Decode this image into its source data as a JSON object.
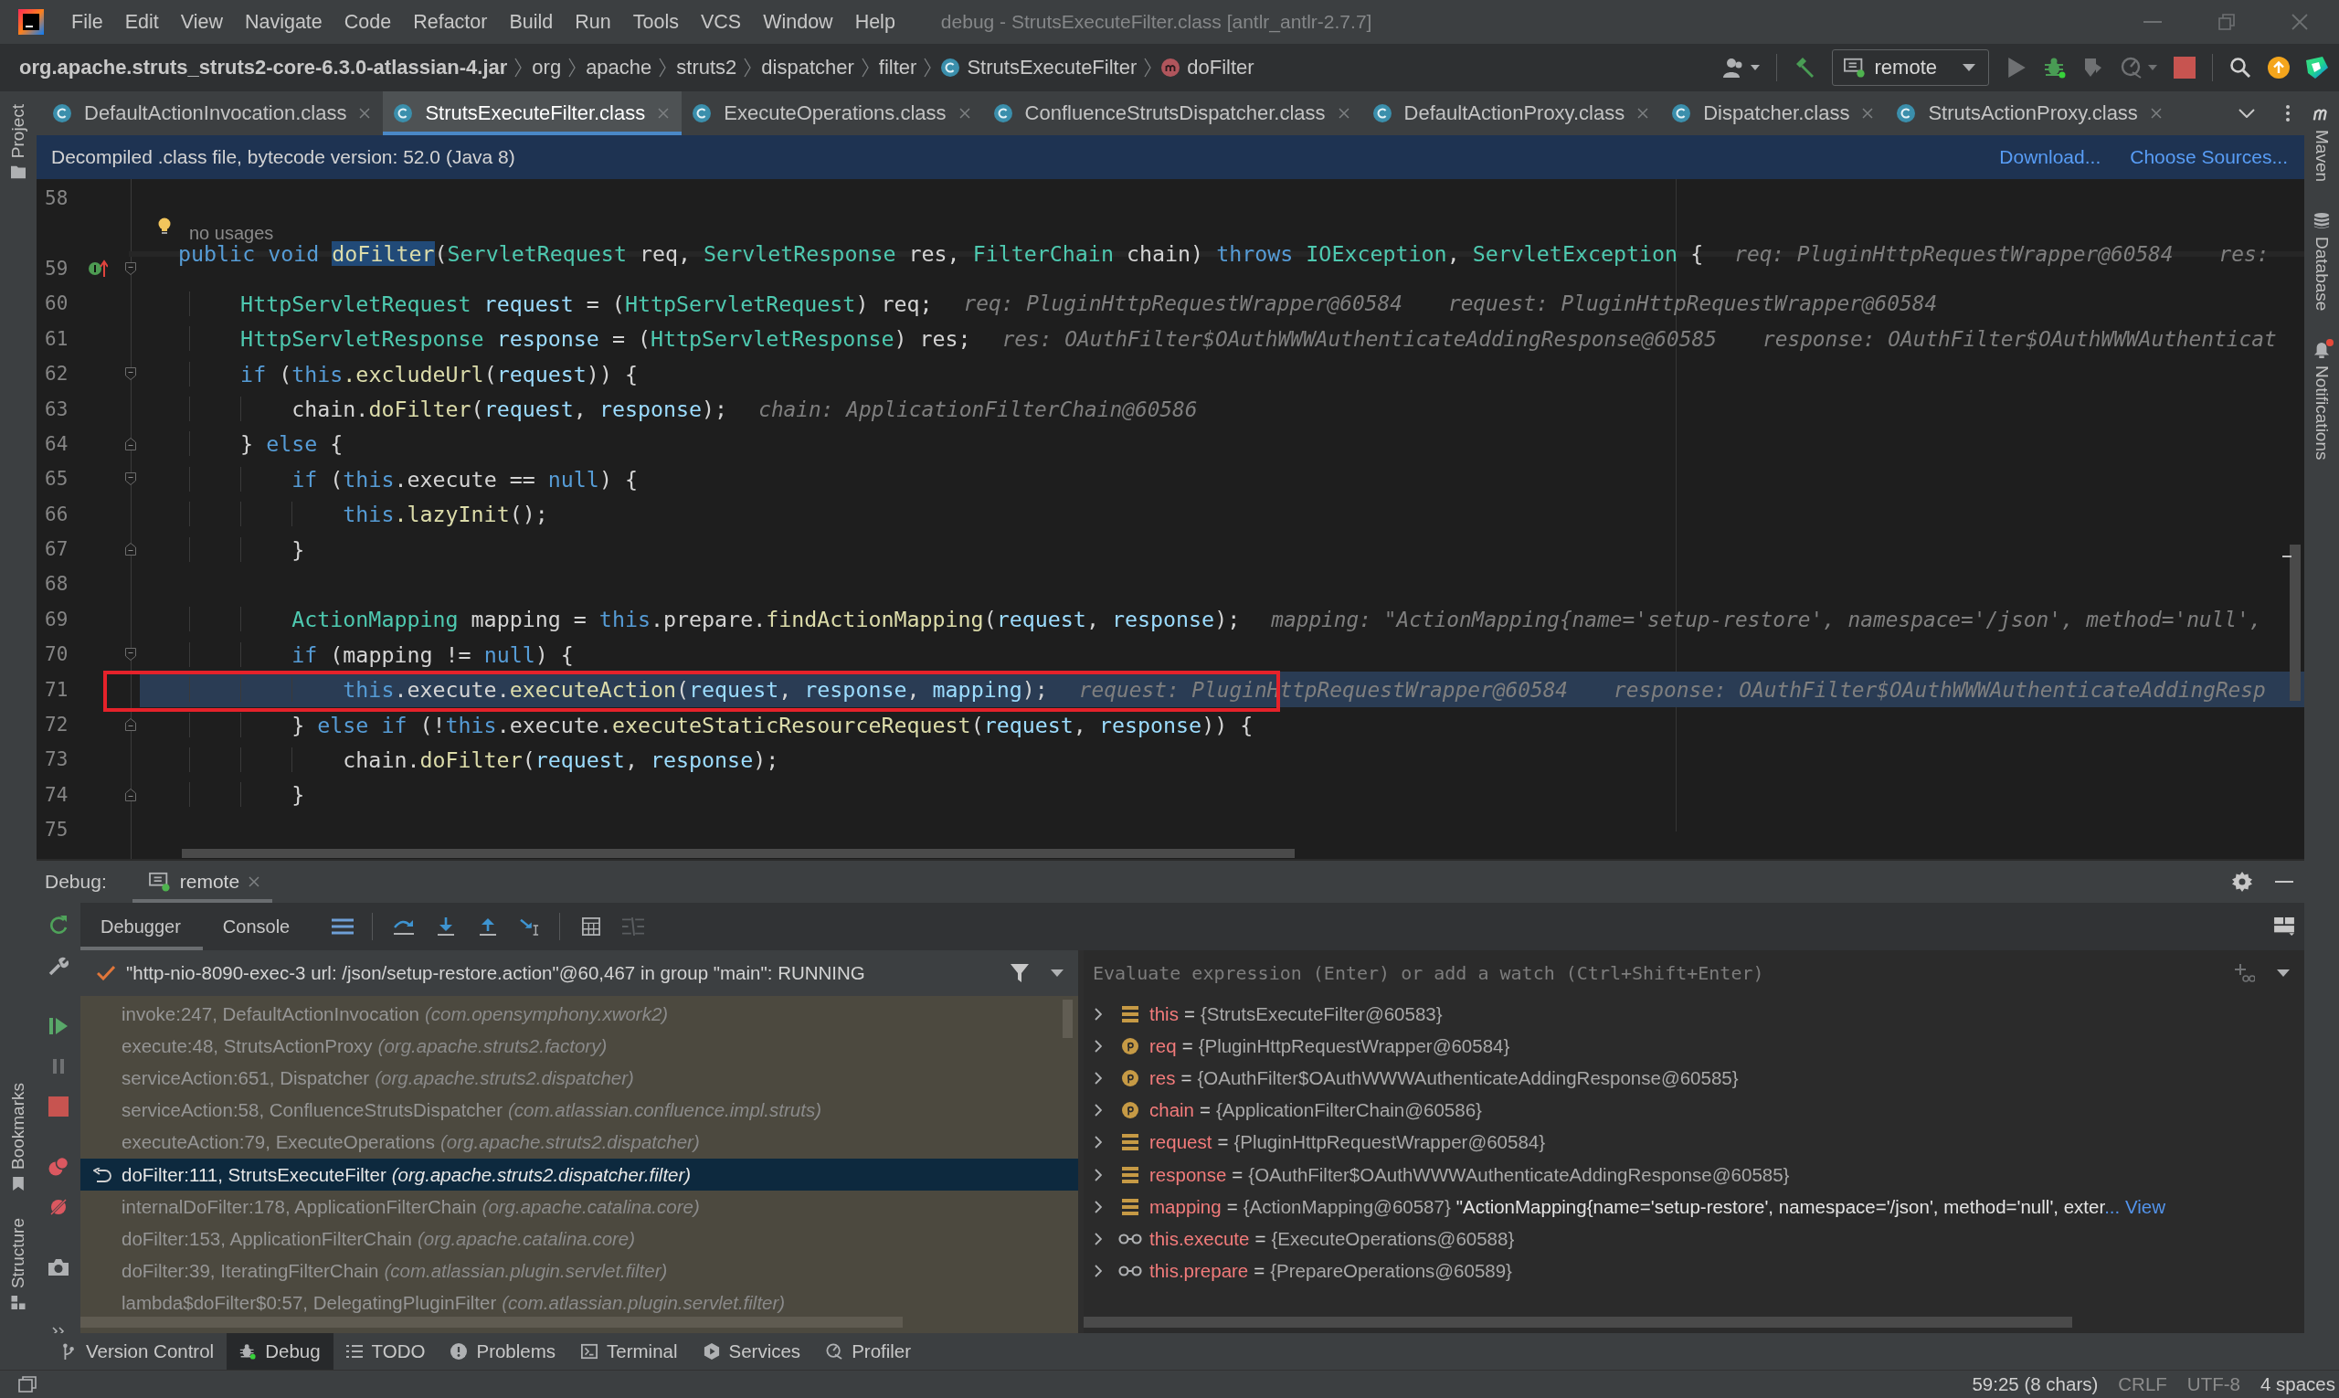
{
  "window": {
    "title": "debug - StrutsExecuteFilter.class [antlr_antlr-2.7.7]"
  },
  "menu": [
    "File",
    "Edit",
    "View",
    "Navigate",
    "Code",
    "Refactor",
    "Build",
    "Run",
    "Tools",
    "VCS",
    "Window",
    "Help"
  ],
  "breadcrumbs": [
    {
      "kind": "jar",
      "label": "org.apache.struts_struts2-core-6.3.0-atlassian-4.jar"
    },
    {
      "kind": "package",
      "label": "org"
    },
    {
      "kind": "package",
      "label": "apache"
    },
    {
      "kind": "package",
      "label": "struts2"
    },
    {
      "kind": "package",
      "label": "dispatcher"
    },
    {
      "kind": "package",
      "label": "filter"
    },
    {
      "kind": "class",
      "label": "StrutsExecuteFilter"
    },
    {
      "kind": "method",
      "label": "doFilter"
    }
  ],
  "toolbar": {
    "run_configuration": "remote"
  },
  "tabs": [
    {
      "label": "DefaultActionInvocation.class",
      "selected": false
    },
    {
      "label": "StrutsExecuteFilter.class",
      "selected": true
    },
    {
      "label": "ExecuteOperations.class",
      "selected": false
    },
    {
      "label": "ConfluenceStrutsDispatcher.class",
      "selected": false
    },
    {
      "label": "DefaultActionProxy.class",
      "selected": false
    },
    {
      "label": "Dispatcher.class",
      "selected": false
    },
    {
      "label": "StrutsActionProxy.class",
      "selected": false
    }
  ],
  "left_tool_strip": {
    "top": [
      {
        "kind": "project",
        "label": "Project"
      }
    ],
    "bottom": [
      {
        "kind": "bookmarks",
        "label": "Bookmarks"
      },
      {
        "kind": "structure",
        "label": "Structure"
      }
    ]
  },
  "right_tool_strip": [
    {
      "kind": "build_tool",
      "label": "Maven",
      "badge": false
    },
    {
      "kind": "database",
      "label": "Database",
      "badge": false
    },
    {
      "kind": "notifications",
      "label": "Notifications",
      "badge": true
    }
  ],
  "banner": {
    "text": "Decompiled .class file, bytecode version: 52.0 (Java 8)",
    "links": [
      "Download...",
      "Choose Sources..."
    ]
  },
  "editor": {
    "lines": [
      {
        "kind": "code",
        "number": "58",
        "marker": false,
        "boxed": false,
        "fold_start": false,
        "fold_end": false,
        "caret_line": false,
        "execution_point": false
      },
      {
        "kind": "annotation",
        "text": "no usages",
        "marker": false,
        "boxed": false,
        "fold_start": false,
        "fold_end": false,
        "caret_line": false,
        "execution_point": false
      },
      {
        "kind": "code",
        "number": "59",
        "marker": true,
        "boxed": false,
        "fold_start": true,
        "fold_end": false,
        "caret_line": true,
        "execution_point": false,
        "tokens": [
          {
            "kind": "keyword",
            "text": "public void "
          },
          {
            "kind": "highlight",
            "text": "doFilter"
          },
          {
            "kind": "plain",
            "text": "("
          },
          {
            "kind": "type",
            "text": "ServletRequest"
          },
          {
            "kind": "plain",
            "text": " req, "
          },
          {
            "kind": "type",
            "text": "ServletResponse"
          },
          {
            "kind": "plain",
            "text": " res, "
          },
          {
            "kind": "type",
            "text": "FilterChain"
          },
          {
            "kind": "plain",
            "text": " chain) "
          },
          {
            "kind": "keyword",
            "text": "throws "
          },
          {
            "kind": "type",
            "text": "IOException"
          },
          {
            "kind": "plain",
            "text": ", "
          },
          {
            "kind": "type",
            "text": "ServletException"
          },
          {
            "kind": "plain",
            "text": " {"
          }
        ],
        "hints": [
          "req: PluginHttpRequestWrapper@60584",
          "res:"
        ]
      },
      {
        "kind": "code",
        "number": "60",
        "marker": false,
        "boxed": false,
        "fold_start": false,
        "fold_end": false,
        "caret_line": false,
        "execution_point": false,
        "tokens": [
          {
            "kind": "type",
            "text": "    HttpServletRequest "
          },
          {
            "kind": "variable",
            "text": "request"
          },
          {
            "kind": "plain",
            "text": " = ("
          },
          {
            "kind": "type",
            "text": "HttpServletRequest"
          },
          {
            "kind": "plain",
            "text": ") req;"
          }
        ],
        "hints": [
          "req: PluginHttpRequestWrapper@60584",
          "request: PluginHttpRequestWrapper@60584"
        ]
      },
      {
        "kind": "code",
        "number": "61",
        "marker": false,
        "boxed": false,
        "fold_start": false,
        "fold_end": false,
        "caret_line": false,
        "execution_point": false,
        "tokens": [
          {
            "kind": "type",
            "text": "    HttpServletResponse "
          },
          {
            "kind": "variable",
            "text": "response"
          },
          {
            "kind": "plain",
            "text": " = ("
          },
          {
            "kind": "type",
            "text": "HttpServletResponse"
          },
          {
            "kind": "plain",
            "text": ") res;"
          }
        ],
        "hints": [
          "res: OAuthFilter$OAuthWWWAuthenticateAddingResponse@60585",
          "response: OAuthFilter$OAuthWWWAuthenticat"
        ]
      },
      {
        "kind": "code",
        "number": "62",
        "marker": false,
        "boxed": false,
        "fold_start": true,
        "fold_end": false,
        "caret_line": false,
        "execution_point": false,
        "tokens": [
          {
            "kind": "keyword",
            "text": "    if"
          },
          {
            "kind": "plain",
            "text": " ("
          },
          {
            "kind": "keyword",
            "text": "this"
          },
          {
            "kind": "method",
            "text": ".excludeUrl"
          },
          {
            "kind": "plain",
            "text": "("
          },
          {
            "kind": "variable",
            "text": "request"
          },
          {
            "kind": "plain",
            "text": ")) {"
          }
        ]
      },
      {
        "kind": "code",
        "number": "63",
        "marker": false,
        "boxed": false,
        "fold_start": false,
        "fold_end": false,
        "caret_line": false,
        "execution_point": false,
        "tokens": [
          {
            "kind": "plain",
            "text": "        chain."
          },
          {
            "kind": "method",
            "text": "doFilter"
          },
          {
            "kind": "plain",
            "text": "("
          },
          {
            "kind": "variable",
            "text": "request"
          },
          {
            "kind": "plain",
            "text": ", "
          },
          {
            "kind": "variable",
            "text": "response"
          },
          {
            "kind": "plain",
            "text": ");"
          }
        ],
        "hints": [
          "chain: ApplicationFilterChain@60586"
        ]
      },
      {
        "kind": "code",
        "number": "64",
        "marker": false,
        "boxed": false,
        "fold_start": false,
        "fold_end": true,
        "caret_line": false,
        "execution_point": false,
        "tokens": [
          {
            "kind": "plain",
            "text": "    } "
          },
          {
            "kind": "keyword",
            "text": "else"
          },
          {
            "kind": "plain",
            "text": " {"
          }
        ]
      },
      {
        "kind": "code",
        "number": "65",
        "marker": false,
        "boxed": false,
        "fold_start": true,
        "fold_end": false,
        "caret_line": false,
        "execution_point": false,
        "tokens": [
          {
            "kind": "keyword",
            "text": "        if"
          },
          {
            "kind": "plain",
            "text": " ("
          },
          {
            "kind": "keyword",
            "text": "this"
          },
          {
            "kind": "plain",
            "text": ".execute == "
          },
          {
            "kind": "keyword",
            "text": "null"
          },
          {
            "kind": "plain",
            "text": ") {"
          }
        ]
      },
      {
        "kind": "code",
        "number": "66",
        "marker": false,
        "boxed": false,
        "fold_start": false,
        "fold_end": false,
        "caret_line": false,
        "execution_point": false,
        "tokens": [
          {
            "kind": "keyword",
            "text": "            this"
          },
          {
            "kind": "method",
            "text": ".lazyInit"
          },
          {
            "kind": "plain",
            "text": "();"
          }
        ]
      },
      {
        "kind": "code",
        "number": "67",
        "marker": false,
        "boxed": false,
        "fold_start": false,
        "fold_end": true,
        "caret_line": false,
        "execution_point": false,
        "tokens": [
          {
            "kind": "plain",
            "text": "        }"
          }
        ]
      },
      {
        "kind": "code",
        "number": "68",
        "marker": false,
        "boxed": false,
        "fold_start": false,
        "fold_end": false,
        "caret_line": false,
        "execution_point": false
      },
      {
        "kind": "code",
        "number": "69",
        "marker": false,
        "boxed": false,
        "fold_start": false,
        "fold_end": false,
        "caret_line": false,
        "execution_point": false,
        "tokens": [
          {
            "kind": "type",
            "text": "        ActionMapping"
          },
          {
            "kind": "plain",
            "text": " mapping = "
          },
          {
            "kind": "keyword",
            "text": "this"
          },
          {
            "kind": "plain",
            "text": ".prepare."
          },
          {
            "kind": "method",
            "text": "findActionMapping"
          },
          {
            "kind": "plain",
            "text": "("
          },
          {
            "kind": "variable",
            "text": "request"
          },
          {
            "kind": "plain",
            "text": ", "
          },
          {
            "kind": "variable",
            "text": "response"
          },
          {
            "kind": "plain",
            "text": ");"
          }
        ],
        "hints": [
          "mapping: \"ActionMapping{name='setup-restore', namespace='/json', method='null',"
        ]
      },
      {
        "kind": "code",
        "number": "70",
        "marker": false,
        "boxed": false,
        "fold_start": true,
        "fold_end": false,
        "caret_line": false,
        "execution_point": false,
        "tokens": [
          {
            "kind": "keyword",
            "text": "        if"
          },
          {
            "kind": "plain",
            "text": " (mapping != "
          },
          {
            "kind": "keyword",
            "text": "null"
          },
          {
            "kind": "plain",
            "text": ") {"
          }
        ]
      },
      {
        "kind": "code",
        "number": "71",
        "marker": false,
        "boxed": true,
        "fold_start": false,
        "fold_end": false,
        "caret_line": false,
        "execution_point": true,
        "tokens": [
          {
            "kind": "keyword",
            "text": "            this"
          },
          {
            "kind": "plain",
            "text": ".execute."
          },
          {
            "kind": "method",
            "text": "executeAction"
          },
          {
            "kind": "plain",
            "text": "("
          },
          {
            "kind": "variable",
            "text": "request"
          },
          {
            "kind": "plain",
            "text": ", "
          },
          {
            "kind": "variable",
            "text": "response"
          },
          {
            "kind": "plain",
            "text": ", "
          },
          {
            "kind": "variable",
            "text": "mapping"
          },
          {
            "kind": "plain",
            "text": ");"
          }
        ],
        "hints": [
          "request: PluginHttpRequestWrapper@60584",
          "response: OAuthFilter$OAuthWWWAuthenticateAddingResp"
        ]
      },
      {
        "kind": "code",
        "number": "72",
        "marker": false,
        "boxed": false,
        "fold_start": false,
        "fold_end": true,
        "caret_line": false,
        "execution_point": false,
        "tokens": [
          {
            "kind": "plain",
            "text": "        } "
          },
          {
            "kind": "keyword",
            "text": "else if"
          },
          {
            "kind": "plain",
            "text": " (!"
          },
          {
            "kind": "keyword",
            "text": "this"
          },
          {
            "kind": "plain",
            "text": ".execute."
          },
          {
            "kind": "method",
            "text": "executeStaticResourceRequest"
          },
          {
            "kind": "plain",
            "text": "("
          },
          {
            "kind": "variable",
            "text": "request"
          },
          {
            "kind": "plain",
            "text": ", "
          },
          {
            "kind": "variable",
            "text": "response"
          },
          {
            "kind": "plain",
            "text": ")) {"
          }
        ]
      },
      {
        "kind": "code",
        "number": "73",
        "marker": false,
        "boxed": false,
        "fold_start": false,
        "fold_end": false,
        "caret_line": false,
        "execution_point": false,
        "tokens": [
          {
            "kind": "plain",
            "text": "            chain."
          },
          {
            "kind": "method",
            "text": "doFilter"
          },
          {
            "kind": "plain",
            "text": "("
          },
          {
            "kind": "variable",
            "text": "request"
          },
          {
            "kind": "plain",
            "text": ", "
          },
          {
            "kind": "variable",
            "text": "response"
          },
          {
            "kind": "plain",
            "text": ");"
          }
        ]
      },
      {
        "kind": "code",
        "number": "74",
        "marker": false,
        "boxed": false,
        "fold_start": false,
        "fold_end": true,
        "caret_line": false,
        "execution_point": false,
        "tokens": [
          {
            "kind": "plain",
            "text": "        }"
          }
        ]
      },
      {
        "kind": "code",
        "number": "75",
        "marker": false,
        "boxed": false,
        "fold_start": false,
        "fold_end": false,
        "caret_line": false,
        "execution_point": false
      }
    ]
  },
  "debug": {
    "title": "Debug:",
    "session": "remote",
    "tabs": [
      {
        "label": "Debugger",
        "selected": true
      },
      {
        "label": "Console",
        "selected": false
      }
    ],
    "thread": "\"http-nio-8090-exec-3 url: /json/setup-restore.action\"@60,467 in group \"main\": RUNNING",
    "frames": [
      {
        "method": "invoke:247, DefaultActionInvocation",
        "package": "(com.opensymphony.xwork2)",
        "selected": false
      },
      {
        "method": "execute:48, StrutsActionProxy",
        "package": "(org.apache.struts2.factory)",
        "selected": false
      },
      {
        "method": "serviceAction:651, Dispatcher",
        "package": "(org.apache.struts2.dispatcher)",
        "selected": false
      },
      {
        "method": "serviceAction:58, ConfluenceStrutsDispatcher",
        "package": "(com.atlassian.confluence.impl.struts)",
        "selected": false
      },
      {
        "method": "executeAction:79, ExecuteOperations",
        "package": "(org.apache.struts2.dispatcher)",
        "selected": false
      },
      {
        "method": "doFilter:111, StrutsExecuteFilter",
        "package": "(org.apache.struts2.dispatcher.filter)",
        "selected": true
      },
      {
        "method": "internalDoFilter:178, ApplicationFilterChain",
        "package": "(org.apache.catalina.core)",
        "selected": false
      },
      {
        "method": "doFilter:153, ApplicationFilterChain",
        "package": "(org.apache.catalina.core)",
        "selected": false
      },
      {
        "method": "doFilter:39, IteratingFilterChain",
        "package": "(com.atlassian.plugin.servlet.filter)",
        "selected": false
      },
      {
        "method": "lambda$doFilter$0:57, DelegatingPluginFilter",
        "package": "(com.atlassian.plugin.servlet.filter)",
        "selected": false
      }
    ],
    "evaluate": {
      "placeholder": "Evaluate expression (Enter) or add a watch (Ctrl+Shift+Enter)"
    },
    "variables": [
      {
        "kind": "local",
        "name": "this",
        "operator": "=",
        "value": "{StrutsExecuteFilter@60583}"
      },
      {
        "kind": "param",
        "name": "req",
        "operator": "=",
        "value": "{PluginHttpRequestWrapper@60584}"
      },
      {
        "kind": "param",
        "name": "res",
        "operator": "=",
        "value": "{OAuthFilter$OAuthWWWAuthenticateAddingResponse@60585}"
      },
      {
        "kind": "param",
        "name": "chain",
        "operator": "=",
        "value": "{ApplicationFilterChain@60586}"
      },
      {
        "kind": "local",
        "name": "request",
        "operator": "=",
        "value": "{PluginHttpRequestWrapper@60584}"
      },
      {
        "kind": "local",
        "name": "response",
        "operator": "=",
        "value": "{OAuthFilter$OAuthWWWAuthenticateAddingResponse@60585}"
      },
      {
        "kind": "local",
        "name": "mapping",
        "operator": "=",
        "value": "{ActionMapping@60587}",
        "string": "\"ActionMapping{name='setup-restore', namespace='/json', method='null', exter",
        "link": "... View"
      },
      {
        "kind": "watch",
        "name": "this.execute",
        "operator": "=",
        "value": "{ExecuteOperations@60588}"
      },
      {
        "kind": "watch",
        "name": "this.prepare",
        "operator": "=",
        "value": "{PrepareOperations@60589}"
      }
    ]
  },
  "tool_windows": [
    {
      "kind": "vcs",
      "label": "Version Control",
      "selected": false
    },
    {
      "kind": "debug",
      "label": "Debug",
      "selected": true
    },
    {
      "kind": "todo",
      "label": "TODO",
      "selected": false
    },
    {
      "kind": "problems",
      "label": "Problems",
      "selected": false
    },
    {
      "kind": "terminal",
      "label": "Terminal",
      "selected": false
    },
    {
      "kind": "services",
      "label": "Services",
      "selected": false
    },
    {
      "kind": "profiler",
      "label": "Profiler",
      "selected": false
    }
  ],
  "status_bar": [
    {
      "text": "59:25 (8 chars)",
      "disabled": false
    },
    {
      "text": "CRLF",
      "disabled": true
    },
    {
      "text": "UTF-8",
      "disabled": true
    },
    {
      "text": "4 spaces",
      "disabled": false
    }
  ]
}
